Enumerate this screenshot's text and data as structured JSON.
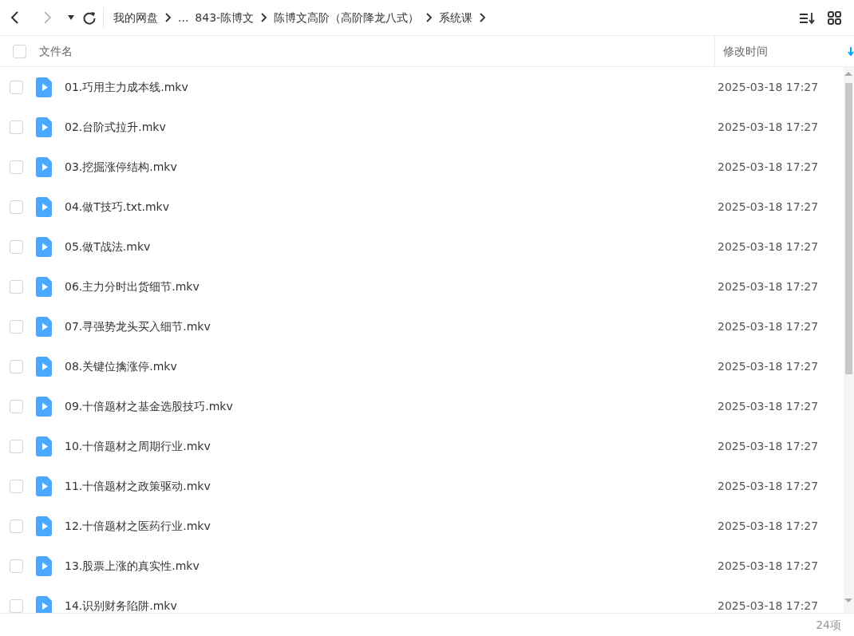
{
  "breadcrumb": [
    {
      "label": "我的网盘",
      "kind": "folder"
    },
    {
      "label": "...",
      "kind": "ellipsis"
    },
    {
      "label": "843-陈博文",
      "kind": "folder"
    },
    {
      "label": "陈博文高阶（高阶降龙八式）",
      "kind": "folder"
    },
    {
      "label": "系统课",
      "kind": "folder"
    }
  ],
  "nav": {
    "forward_disabled": true
  },
  "header": {
    "select_all_checked": false,
    "name_column": "文件名",
    "time_column": "修改时间"
  },
  "files": [
    {
      "name": "01.巧用主力成本线.mkv",
      "modified": "2025-03-18 17:27",
      "checked": false
    },
    {
      "name": "02.台阶式拉升.mkv",
      "modified": "2025-03-18 17:27",
      "checked": false
    },
    {
      "name": "03.挖掘涨停结构.mkv",
      "modified": "2025-03-18 17:27",
      "checked": false
    },
    {
      "name": "04.做T技巧.txt.mkv",
      "modified": "2025-03-18 17:27",
      "checked": false
    },
    {
      "name": "05.做T战法.mkv",
      "modified": "2025-03-18 17:27",
      "checked": false
    },
    {
      "name": "06.主力分时出货细节.mkv",
      "modified": "2025-03-18 17:27",
      "checked": false
    },
    {
      "name": "07.寻强势龙头买入细节.mkv",
      "modified": "2025-03-18 17:27",
      "checked": false
    },
    {
      "name": "08.关键位擒涨停.mkv",
      "modified": "2025-03-18 17:27",
      "checked": false
    },
    {
      "name": "09.十倍题材之基金选股技巧.mkv",
      "modified": "2025-03-18 17:27",
      "checked": false
    },
    {
      "name": "10.十倍题材之周期行业.mkv",
      "modified": "2025-03-18 17:27",
      "checked": false
    },
    {
      "name": "11.十倍题材之政策驱动.mkv",
      "modified": "2025-03-18 17:27",
      "checked": false
    },
    {
      "name": "12.十倍题材之医药行业.mkv",
      "modified": "2025-03-18 17:27",
      "checked": false
    },
    {
      "name": "13.股票上涨的真实性.mkv",
      "modified": "2025-03-18 17:27",
      "checked": false
    },
    {
      "name": "14.识别财务陷阱.mkv",
      "modified": "2025-03-18 17:27",
      "checked": false
    }
  ],
  "status_bar": {
    "count": "24项"
  }
}
